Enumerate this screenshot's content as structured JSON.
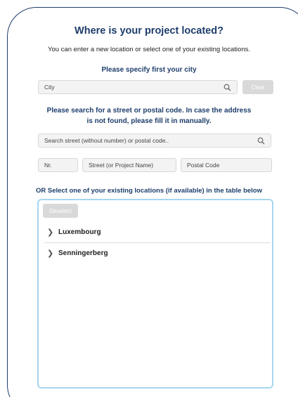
{
  "dialog": {
    "title": "Where is your project located?",
    "subtitle": "You can enter a new location or select one of your existing locations."
  },
  "city": {
    "label": "Please specify first your city",
    "placeholder": "City",
    "clear_label": "Clear",
    "search_icon": "search-icon"
  },
  "street": {
    "label_line1": "Please search for a street or postal code. In case the address",
    "label_line2": "is not found, please fill it in manually.",
    "search_placeholder": "Search street (without number) or postal code..",
    "search_icon": "search-icon",
    "nr_placeholder": "Nr.",
    "street_placeholder": "Street (or Project Name)",
    "postal_placeholder": "Postal Code"
  },
  "existing": {
    "label": "OR Select one of your existing locations (if available) in the table below",
    "deselect_label": "Deselect",
    "items": [
      {
        "label": "Luxembourg",
        "icon": "chevron-right-icon"
      },
      {
        "label": "Senningerberg",
        "icon": "chevron-right-icon"
      }
    ]
  },
  "colors": {
    "brand": "#1e3d6b",
    "table_border": "#a6d6ef",
    "disabled_button": "#d9d9d9"
  }
}
